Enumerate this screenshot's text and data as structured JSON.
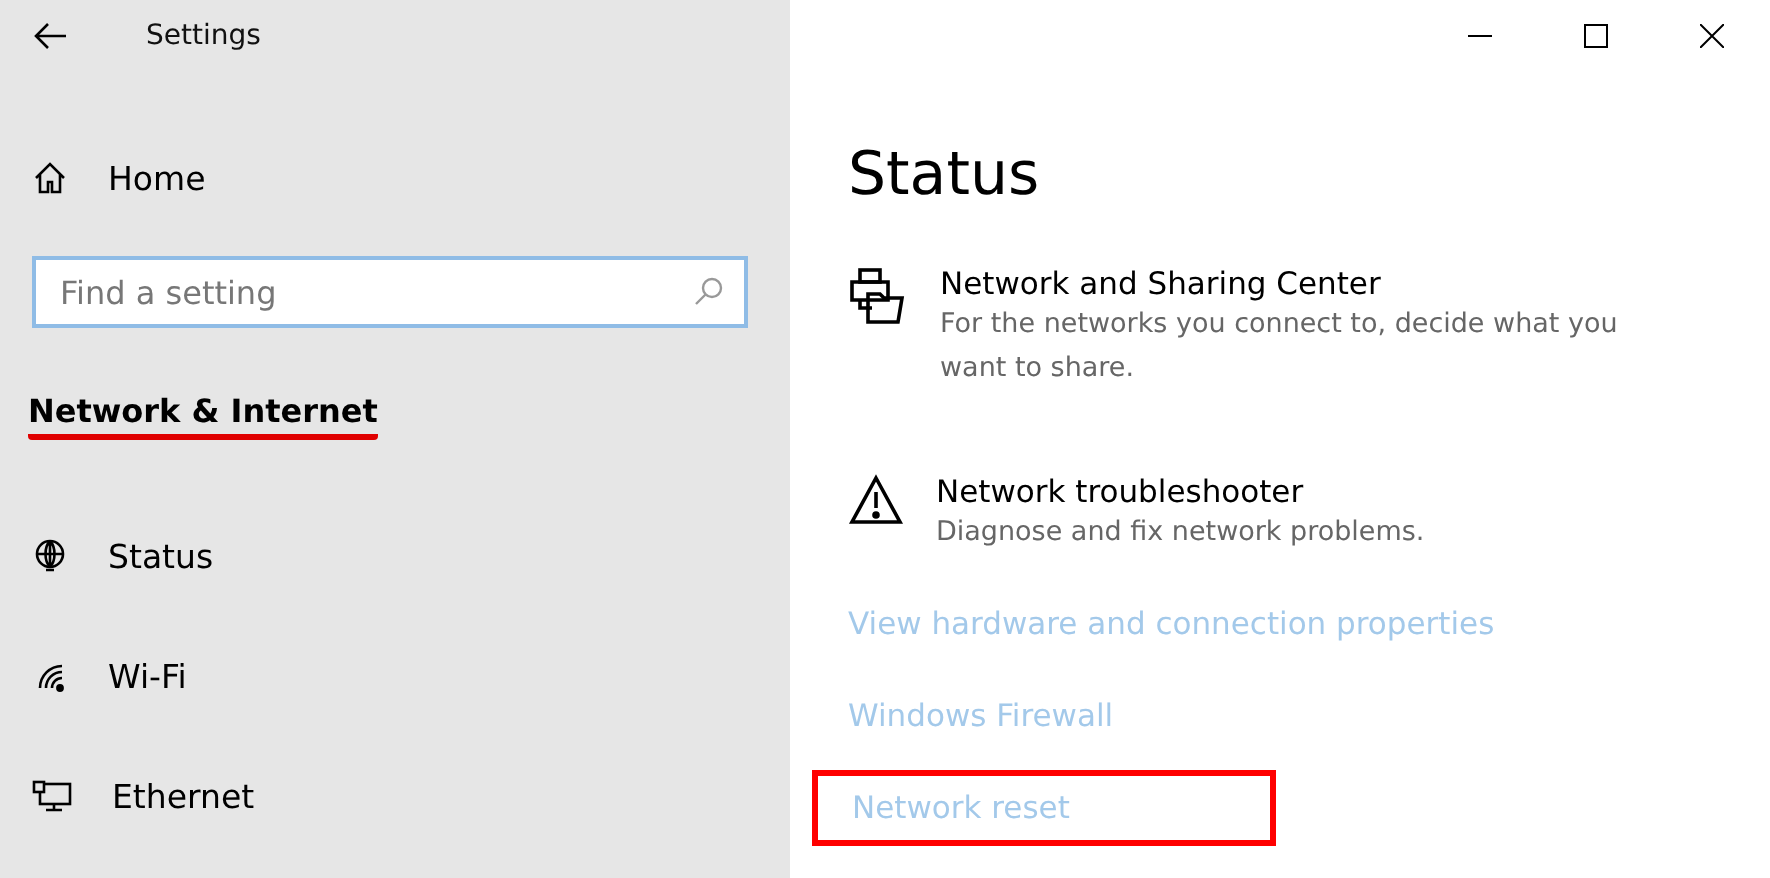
{
  "window": {
    "title": "Settings"
  },
  "sidebar": {
    "home": "Home",
    "search": {
      "placeholder": "Find a setting"
    },
    "section": {
      "label": "Network & Internet",
      "underlined": true
    },
    "items": [
      {
        "label": "Status",
        "selected": false
      },
      {
        "label": "Wi-Fi",
        "selected": false
      },
      {
        "label": "Ethernet",
        "selected": false
      }
    ]
  },
  "content": {
    "heading": "Status",
    "entries": [
      {
        "title": "Network and Sharing Center",
        "description": "For the networks you connect to, decide what you want to share."
      },
      {
        "title": "Network troubleshooter",
        "description": "Diagnose and fix network problems."
      }
    ],
    "links": [
      {
        "label": "View hardware and connection properties",
        "highlighted": false
      },
      {
        "label": "Windows Firewall",
        "highlighted": false
      },
      {
        "label": "Network reset",
        "highlighted": true
      }
    ]
  }
}
